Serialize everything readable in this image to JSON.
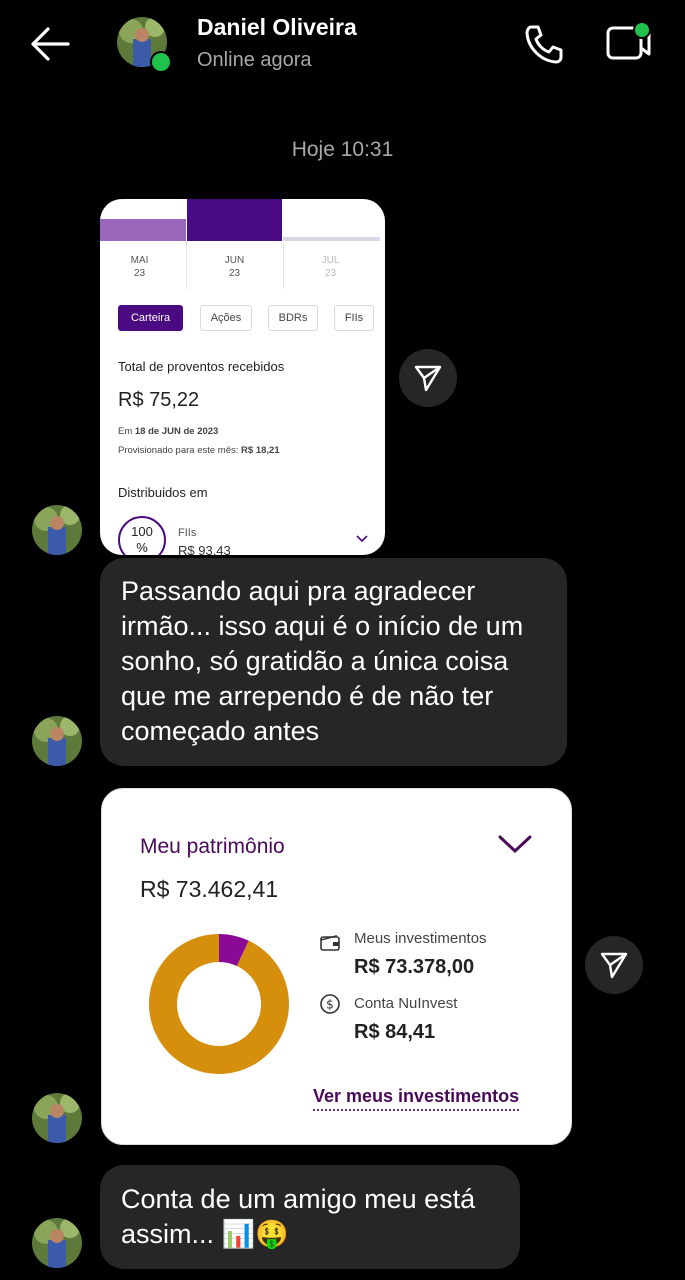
{
  "header": {
    "contact_name": "Daniel Oliveira",
    "status": "Online agora"
  },
  "timestamp": "Hoje 10:31",
  "messages": {
    "card1": {
      "months": [
        {
          "name": "MAI",
          "year": "23"
        },
        {
          "name": "JUN",
          "year": "23"
        },
        {
          "name": "JUL",
          "year": "23"
        }
      ],
      "tabs": [
        "Carteira",
        "Ações",
        "BDRs",
        "FIIs"
      ],
      "proventos_label": "Total de proventos recebidos",
      "proventos_value": "R$ 75,22",
      "date_prefix": "Em ",
      "date_value": "18 de JUN de 2023",
      "provisionado_label": "Provisionado para este mês: ",
      "provisionado_value": "R$ 18,21",
      "distribuidos_label": "Distribuidos em",
      "circle_pct": "100",
      "circle_pct_symbol": "%",
      "fii_label": "FIIs",
      "fii_value": "R$ 93,43"
    },
    "text1": "Passando aqui pra agradecer irmão... isso aqui é o início de um sonho, só gratidão a única coisa que me arrependo é de não ter começado antes",
    "card2": {
      "title": "Meu patrimônio",
      "total": "R$ 73.462,41",
      "investimentos_label": "Meus investimentos",
      "investimentos_value": "R$ 73.378,00",
      "conta_label": "Conta NuInvest",
      "conta_value": "R$ 84,41",
      "link": "Ver meus investimentos",
      "donut": {
        "segments": [
          {
            "value": 73378.0,
            "color": "#d68f0d"
          },
          {
            "value": 84.41,
            "color": "#8a0a96"
          }
        ]
      }
    },
    "text2": "Conta de um amigo meu está assim... 📊🤑"
  },
  "colors": {
    "background": "#000000",
    "bubble": "#262626",
    "online": "#1fc24b",
    "brand_purple": "#4a0a82",
    "donut_gold": "#d68f0d"
  },
  "icons": [
    "back-arrow-icon",
    "phone-icon",
    "video-call-icon",
    "share-icon",
    "chevron-down-icon",
    "wallet-icon",
    "dollar-circle-icon"
  ]
}
